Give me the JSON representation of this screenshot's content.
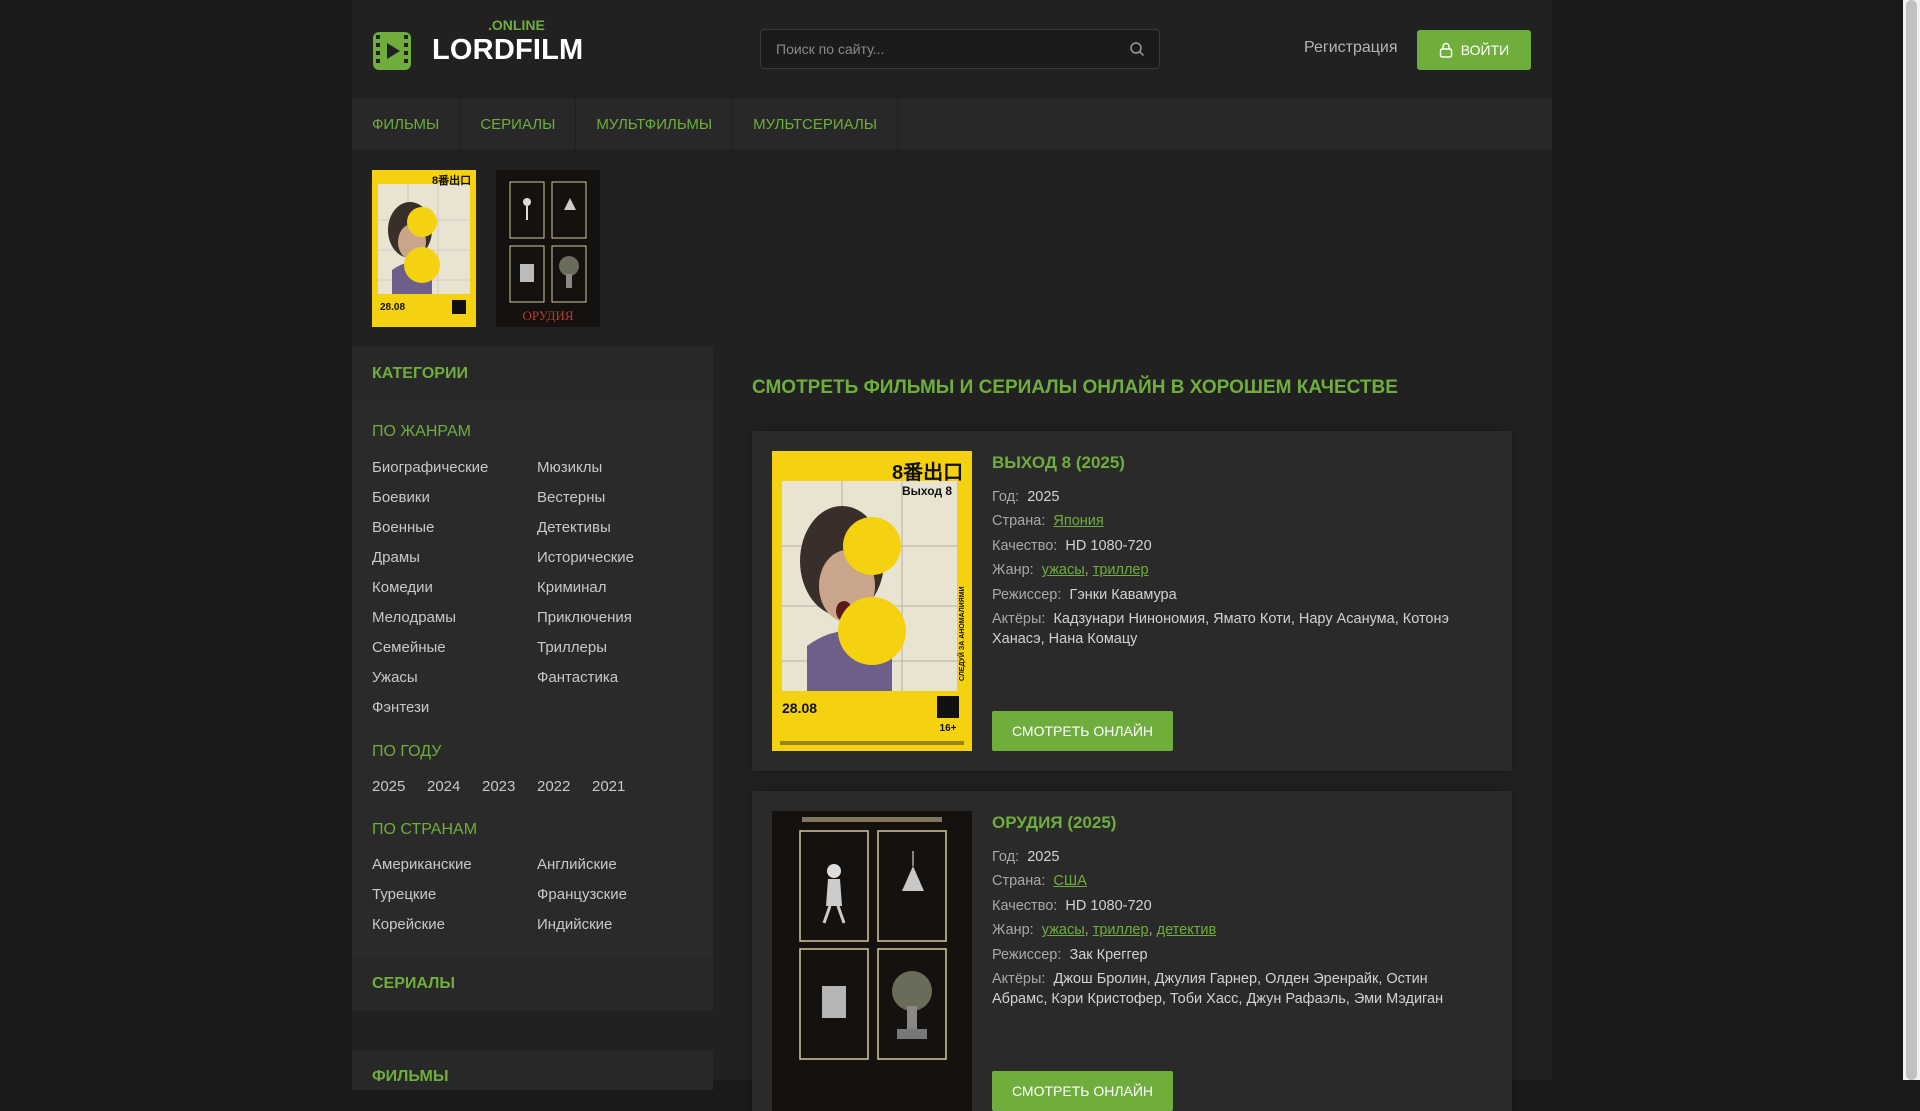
{
  "logo": {
    "online": ".ONLINE",
    "name": "LORDFILM"
  },
  "search": {
    "placeholder": "Поиск по сайту..."
  },
  "header": {
    "register": "Регистрация",
    "login": "ВОЙТИ"
  },
  "nav": [
    "ФИЛЬМЫ",
    "СЕРИАЛЫ",
    "МУЛЬТФИЛЬМЫ",
    "МУЛЬТСЕРИАЛЫ"
  ],
  "sidebar": {
    "categories_title": "КАТЕГОРИИ",
    "genres_title": "ПО ЖАНРАМ",
    "genres_left": [
      "Биографические",
      "Боевики",
      "Военные",
      "Драмы",
      "Комедии",
      "Мелодрамы",
      "Семейные",
      "Ужасы",
      "Фэнтези"
    ],
    "genres_right": [
      "Мюзиклы",
      "Вестерны",
      "Детективы",
      "Исторические",
      "Криминал",
      "Приключения",
      "Триллеры",
      "Фантастика"
    ],
    "years_title": "ПО ГОДУ",
    "years": [
      "2025",
      "2024",
      "2023",
      "2022",
      "2021"
    ],
    "countries_title": "ПО СТРАНАМ",
    "countries_left": [
      "Американские",
      "Турецкие",
      "Корейские"
    ],
    "countries_right": [
      "Английские",
      "Французские",
      "Индийские"
    ],
    "serials_title": "СЕРИАЛЫ",
    "films_title": "ФИЛЬМЫ"
  },
  "main": {
    "title": "СМОТРЕТЬ ФИЛЬМЫ И СЕРИАЛЫ ОНЛАЙН В ХОРОШЕМ КАЧЕСТВЕ",
    "labels": {
      "year": "Год:",
      "country": "Страна:",
      "quality": "Качество:",
      "genre": "Жанр:",
      "director": "Режиссер:",
      "actors": "Актёры:"
    },
    "movies": [
      {
        "title": "ВЫХОД 8 (2025)",
        "year": "2025",
        "country": "Япония",
        "quality": "HD 1080-720",
        "genres": [
          "ужасы",
          "триллер"
        ],
        "director": "Гэнки Кавамура",
        "actors": "Кадзунари Нинономия, Ямато Коти, Нару Асанума, Котонэ Ханасэ, Нана Комацу",
        "watch": "СМОТРЕТЬ ОНЛАЙН",
        "poster": {
          "top_text": "8番出口",
          "sub_text": "Выход 8",
          "date": "28.08",
          "rating": "16+",
          "side": "СЛЕДУЙ ЗА АНОМАЛИЯМИ"
        }
      },
      {
        "title": "ОРУДИЯ (2025)",
        "year": "2025",
        "country": "США",
        "quality": "HD 1080-720",
        "genres": [
          "ужасы",
          "триллер",
          "детектив"
        ],
        "director": "Зак Креггер",
        "actors": "Джош Бролин, Джулия Гарнер, Олден Эренрайк, Остин Абрамс, Кэри Кристофер, Тоби Хасс, Джун Рафаэль, Эми Мэдиган",
        "watch": "СМОТРЕТЬ ОНЛАЙН",
        "poster": {
          "title": "ОРУДИЯ"
        }
      }
    ]
  },
  "colors": {
    "accent": "#6fae3c",
    "bg": "#212121",
    "panel": "#282828",
    "poster_yellow": "#f5d20f"
  }
}
